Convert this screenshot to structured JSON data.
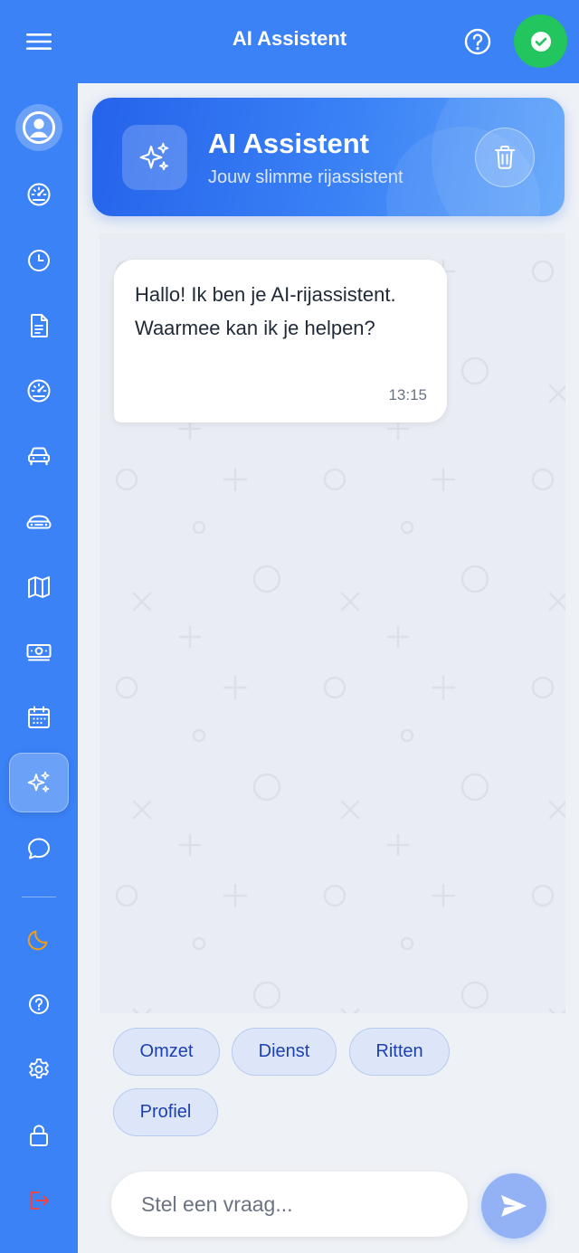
{
  "app": {
    "title": "AI Assistent",
    "colors": {
      "primary": "#3b82f6",
      "status": "#22c55e",
      "moon": "#f59e0b",
      "logout": "#ef4444"
    }
  },
  "topbar": {
    "menu_icon": "hamburger-icon",
    "help_icon": "question-circle-icon",
    "status_icon": "check-circle-icon"
  },
  "sidebar": {
    "items": [
      {
        "name": "profile",
        "icon": "user-circle-icon"
      },
      {
        "name": "dashboard",
        "icon": "speedometer-icon"
      },
      {
        "name": "history",
        "icon": "clock-icon"
      },
      {
        "name": "documents",
        "icon": "document-icon"
      },
      {
        "name": "speed",
        "icon": "gauge-icon"
      },
      {
        "name": "car",
        "icon": "car-icon"
      },
      {
        "name": "taxi",
        "icon": "car-front-icon"
      },
      {
        "name": "map",
        "icon": "map-icon"
      },
      {
        "name": "money",
        "icon": "cash-icon"
      },
      {
        "name": "calendar",
        "icon": "calendar-icon"
      },
      {
        "name": "ai-assistant",
        "icon": "sparkles-icon",
        "active": true
      },
      {
        "name": "chat",
        "icon": "chat-bubble-icon"
      },
      {
        "name": "dark-mode",
        "icon": "moon-icon"
      },
      {
        "name": "help",
        "icon": "question-circle-icon"
      },
      {
        "name": "settings",
        "icon": "gear-icon"
      },
      {
        "name": "lock",
        "icon": "lock-icon"
      },
      {
        "name": "logout",
        "icon": "logout-icon"
      }
    ]
  },
  "header": {
    "title": "AI Assistent",
    "subtitle": "Jouw slimme rijassistent",
    "icon": "sparkles-icon",
    "trash_icon": "trash-icon"
  },
  "chat": {
    "messages": [
      {
        "text": "Hallo! Ik ben je AI-rijassistent. Waarmee kan ik je helpen?",
        "time": "13:15"
      }
    ]
  },
  "quick_replies": [
    "Omzet",
    "Dienst",
    "Ritten",
    "Profiel"
  ],
  "input": {
    "placeholder": "Stel een vraag...",
    "value": "",
    "send_icon": "send-icon"
  }
}
